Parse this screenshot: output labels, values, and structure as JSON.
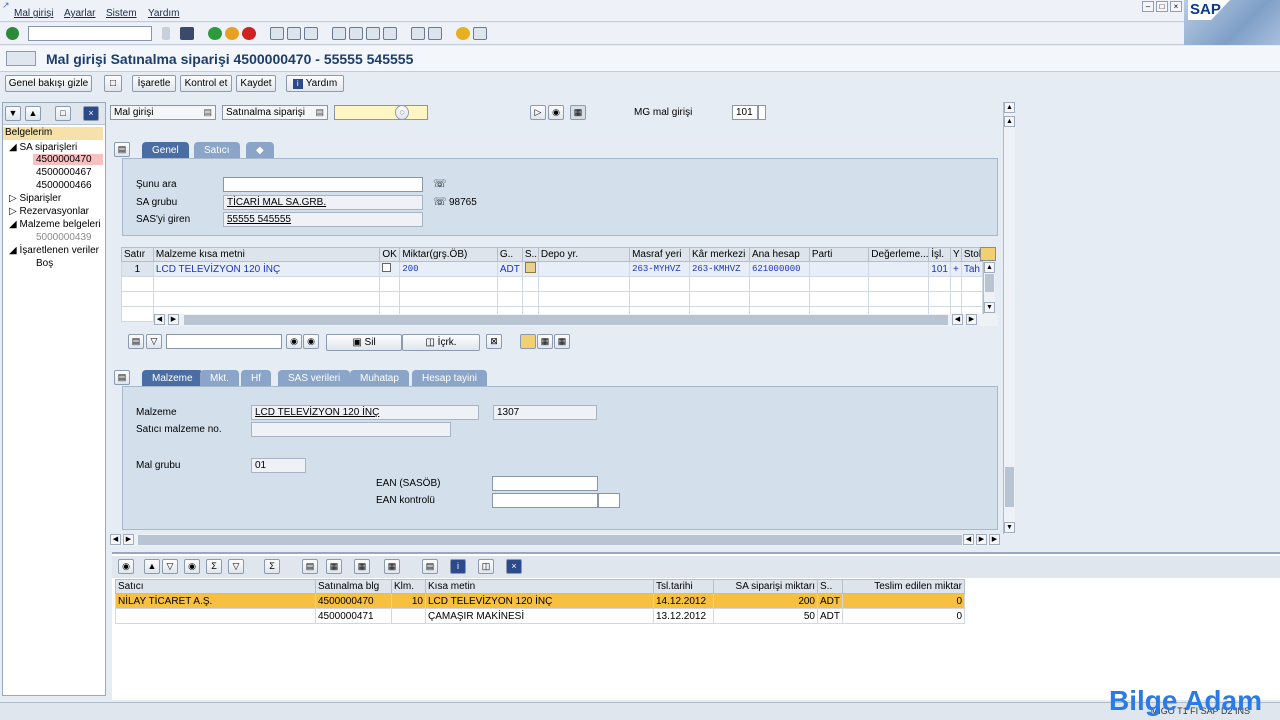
{
  "menu": [
    "Mal girişi",
    "Ayarlar",
    "Sistem",
    "Yardım"
  ],
  "window_controls": [
    "–",
    "□",
    "×"
  ],
  "brand": "SAP",
  "title": "Mal girişi Satınalma siparişi 4500000470 - 55555 545555",
  "appbar": {
    "summary_btn": "Genel bakışı gizle",
    "mark_btn": "İşaretle",
    "check_btn": "Kontrol et",
    "save_btn": "Kaydet",
    "help_btn": "Yardım"
  },
  "sidebar": {
    "root": "Belgelerim",
    "sa_orders": "SA siparişleri",
    "orders": [
      "4500000470",
      "4500000467",
      "4500000466"
    ],
    "siparisler": "Siparişler",
    "rezervasyonlar": "Rezervasyonlar",
    "malzeme_belgeleri": "Malzeme belgeleri",
    "mat_doc": "5000000439",
    "marked": "İşaretlenen veriler",
    "empty": "Boş"
  },
  "header_fields": {
    "action": "Mal girişi",
    "ref_doc": "Satınalma siparişi",
    "mg_label": "MG mal girişi",
    "mg_value": "101"
  },
  "header_tabs": [
    "Genel",
    "Satıcı"
  ],
  "general": {
    "sunu_ara_label": "Şunu ara",
    "sunu_ara_value": "",
    "sa_grubu_label": "SA grubu",
    "sa_grubu_value": "TİCARİ MAL SA.GRB.",
    "phone": "98765",
    "sas_giren_label": "SAS'yi giren",
    "sas_giren_value": "55555 545555"
  },
  "items_table": {
    "columns": [
      "Satır",
      "Malzeme kısa metni",
      "OK",
      "Miktar(grş.ÖB)",
      "G..",
      "S..",
      "Depo yr.",
      "Masraf yeri",
      "Kâr merkezi",
      "Ana hesap",
      "Parti",
      "Değerleme...",
      "İşl.",
      "Y",
      "Stok"
    ],
    "rows": [
      [
        "1",
        "LCD TELEVİZYON 120 İNÇ",
        "",
        "200",
        "ADT",
        "",
        "",
        "263-MYHVZ",
        "263-KMHVZ",
        "621000000",
        "",
        "",
        "101",
        "+",
        "Tah"
      ]
    ]
  },
  "item_toolbar": {
    "delete": "Sil",
    "copy": "İçrk."
  },
  "detail_tabs": [
    "Malzeme",
    "Mkt.",
    "Hf",
    "SAS verileri",
    "Muhatap",
    "Hesap tayini"
  ],
  "detail": {
    "malzeme_label": "Malzeme",
    "malzeme_value": "LCD TELEVİZYON 120 İNÇ",
    "malzeme_no": "1307",
    "satici_mat_label": "Satıcı malzeme no.",
    "mal_grubu_label": "Mal grubu",
    "mal_grubu_value": "01",
    "ean_label": "EAN (SASÖB)",
    "ean_ctrl_label": "EAN kontrolü"
  },
  "bottom_table": {
    "columns": [
      "Satıcı",
      "Satınalma blg",
      "Klm.",
      "Kısa metin",
      "Tsl.tarihi",
      "SA siparişi miktarı",
      "S..",
      "Teslim edilen miktar"
    ],
    "rows": [
      [
        "NİLAY TİCARET A.Ş.",
        "4500000470",
        "10",
        "LCD TELEVİZYON 120 İNÇ",
        "14.12.2012",
        "200",
        "ADT",
        "0"
      ],
      [
        "",
        "4500000471",
        "",
        "ÇAMAŞIR MAKİNESİ",
        "13.12.2012",
        "50",
        "ADT",
        "0"
      ]
    ]
  },
  "status": "MIGO  T1  FI  SAP  D2  INS",
  "watermark": "Bilge Adam"
}
